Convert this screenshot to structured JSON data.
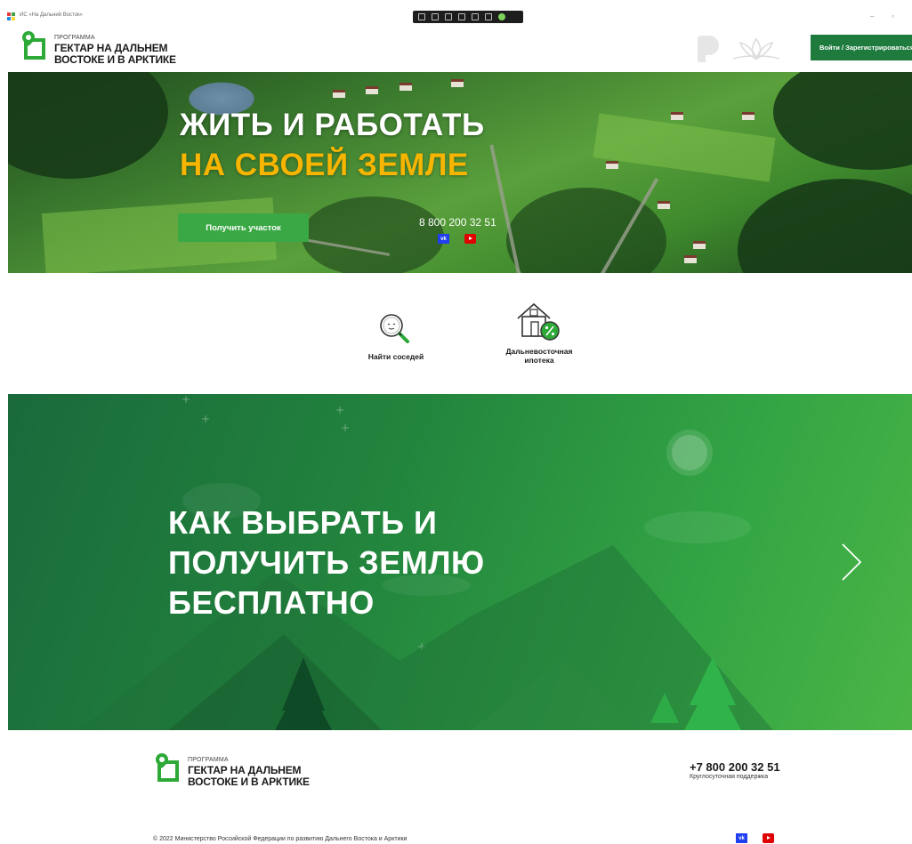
{
  "window": {
    "title": "ИС «На Дальний Восток»",
    "minimize": "–",
    "restore": "▫"
  },
  "header": {
    "logo": {
      "small": "ПРОГРАММА",
      "line1": "ГЕКТАР НА ДАЛЬНЕМ",
      "line2": "ВОСТОКЕ И В АРКТИКЕ"
    },
    "login_label": "Войти / Зарегистрироваться"
  },
  "hero": {
    "title_line1": "ЖИТЬ И РАБОТАТЬ",
    "title_line2": "НА СВОЕЙ ЗЕМЛЕ",
    "button_label": "Получить участок",
    "phone": "8 800 200 32 51",
    "vk_label": "vk"
  },
  "services": [
    {
      "label": "Найти соседей",
      "icon": "magnifier-icon"
    },
    {
      "label_line1": "Дальневосточная",
      "label_line2": "ипотека",
      "icon": "house-percent-icon"
    }
  ],
  "banner": {
    "title_line1": "КАК ВЫБРАТЬ И",
    "title_line2": "ПОЛУЧИТЬ ЗЕМЛЮ",
    "title_line3": "БЕСПЛАТНО"
  },
  "footer": {
    "logo": {
      "small": "ПРОГРАММА",
      "line1": "ГЕКТАР НА ДАЛЬНЕМ",
      "line2": "ВОСТОКЕ И В АРКТИКЕ"
    },
    "phone": "+7 800 200 32 51",
    "phone_note": "Круглосуточная поддержка",
    "copyright": "© 2022 Министерство Российской Федерации по развитию Дальнего Востока и Арктики",
    "vk_label": "vk"
  },
  "colors": {
    "brand_green": "#2da937",
    "button_green": "#3aa844",
    "login_green": "#1f7a3e",
    "accent_yellow": "#f7b500"
  }
}
